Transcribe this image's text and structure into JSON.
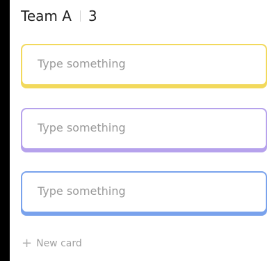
{
  "column": {
    "title": "Team A",
    "count": "3"
  },
  "cards": [
    {
      "placeholder": "Type something",
      "accent": "#f2d95c"
    },
    {
      "placeholder": "Type something",
      "accent": "#b6a2ec"
    },
    {
      "placeholder": "Type something",
      "accent": "#79a2ec"
    }
  ],
  "footer": {
    "new_card_label": "New card",
    "plus_icon": "+"
  }
}
